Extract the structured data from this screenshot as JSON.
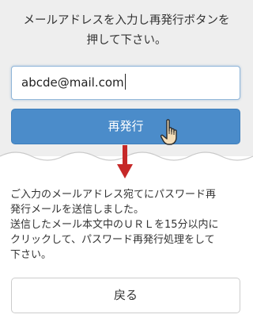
{
  "instruction": {
    "line1": "メールアドレスを入力し再発行ボタンを",
    "line2": "押して下さい。"
  },
  "email_field": {
    "value": "abcde@mail.com"
  },
  "submit_button": {
    "label": "再発行"
  },
  "result_message": {
    "lines": [
      "ご入力のメールアドレス宛てにパスワード再",
      "発行メールを送信しました。",
      "送信したメール本文中のＵＲＬを15分以内に",
      "クリックして、パスワード再発行処理をして",
      "下さい。"
    ]
  },
  "back_button": {
    "label": "戻る"
  },
  "icons": {
    "cursor": "pointing-hand-icon",
    "arrow": "down-arrow-icon"
  },
  "colors": {
    "top_background": "#eeeeee",
    "button_primary": "#4b8cca",
    "arrow": "#c62828",
    "field_border": "#8fb5d8"
  }
}
